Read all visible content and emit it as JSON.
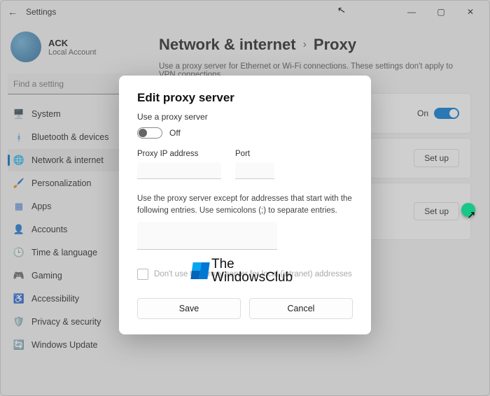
{
  "titlebar": {
    "title": "Settings"
  },
  "account": {
    "name": "ACK",
    "sub": "Local Account"
  },
  "search": {
    "placeholder": "Find a setting"
  },
  "sidebar": {
    "items": [
      {
        "icon": "🖥️",
        "label": "System"
      },
      {
        "icon": "ᚼ",
        "label": "Bluetooth & devices",
        "color": "#0078d4"
      },
      {
        "icon": "🌐",
        "label": "Network & internet",
        "color": "#0078d4"
      },
      {
        "icon": "🖌️",
        "label": "Personalization",
        "color": "#d37a3a"
      },
      {
        "icon": "▦",
        "label": "Apps",
        "color": "#3a7ad3"
      },
      {
        "icon": "👤",
        "label": "Accounts",
        "color": "#c77d52"
      },
      {
        "icon": "🕒",
        "label": "Time & language",
        "color": "#555"
      },
      {
        "icon": "🎮",
        "label": "Gaming",
        "color": "#555"
      },
      {
        "icon": "♿",
        "label": "Accessibility",
        "color": "#1f7a5a"
      },
      {
        "icon": "🛡️",
        "label": "Privacy & security",
        "color": "#3a7ad3"
      },
      {
        "icon": "🔄",
        "label": "Windows Update",
        "color": "#0078d4"
      }
    ]
  },
  "breadcrumb": {
    "parent": "Network & internet",
    "current": "Proxy"
  },
  "page_desc": "Use a proxy server for Ethernet or Wi-Fi connections. These settings don't apply to VPN connections.",
  "cards": {
    "toggle_label": "On",
    "setup_label": "Set up"
  },
  "modal": {
    "title": "Edit proxy server",
    "sub": "Use a proxy server",
    "toggle_label": "Off",
    "ip_label": "Proxy IP address",
    "port_label": "Port",
    "except_text": "Use the proxy server except for addresses that start with the following entries. Use semicolons (;) to separate entries.",
    "check_label": "Don't use the proxy server for local (intranet) addresses",
    "save": "Save",
    "cancel": "Cancel"
  },
  "watermark": {
    "line1": "The",
    "line2": "WindowsClub"
  }
}
